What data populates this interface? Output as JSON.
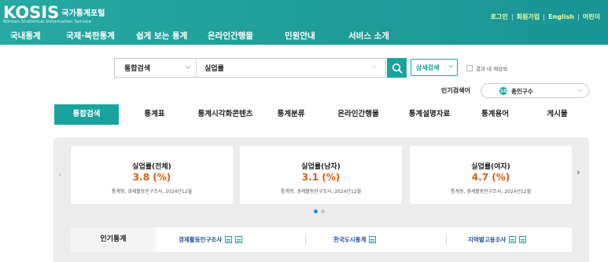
{
  "header": {
    "logo": "KOSIS",
    "logo_kr": "국가통계포털",
    "logo_sub": "KOrean Statistical Information Service",
    "nav": [
      "국내통계",
      "국제·북한통계",
      "쉽게 보는 통계",
      "온라인간행물",
      "민원안내",
      "서비스 소개"
    ],
    "util": [
      "로그인",
      "회원가입",
      "English",
      "어린이"
    ]
  },
  "search": {
    "scope": "통합검색",
    "query": "실업률",
    "detail_label": "상세검색",
    "recheck_label": "결과 내 재검색",
    "popular_label": "인기검색어",
    "popular_rank": "10",
    "popular_term": "총인구수"
  },
  "tabs": [
    "통합검색",
    "통계표",
    "통계시각화콘텐츠",
    "통계분류",
    "온라인간행물",
    "통계설명자료",
    "통계용어",
    "게시물"
  ],
  "cards": [
    {
      "title": "실업률(전체)",
      "value": "3.8 (%)",
      "source": "통계청, 경제활동인구조사, 2024년12월"
    },
    {
      "title": "실업률(남자)",
      "value": "3.1 (%)",
      "source": "통계청, 경제활동인구조사, 2024년12월"
    },
    {
      "title": "실업률(여자)",
      "value": "4.7 (%)",
      "source": "통계청, 경제활동인구조사, 2024년12월"
    }
  ],
  "popular_stats": {
    "label": "인기통계",
    "items": [
      "경제활동인구조사",
      "한국도시통계",
      "지역별고용조사"
    ]
  },
  "colors": {
    "brand_teal": "#1aa39d",
    "value_orange": "#e05a0c",
    "link_blue": "#1d4e9e",
    "active_dot": "#1a8fd9"
  }
}
